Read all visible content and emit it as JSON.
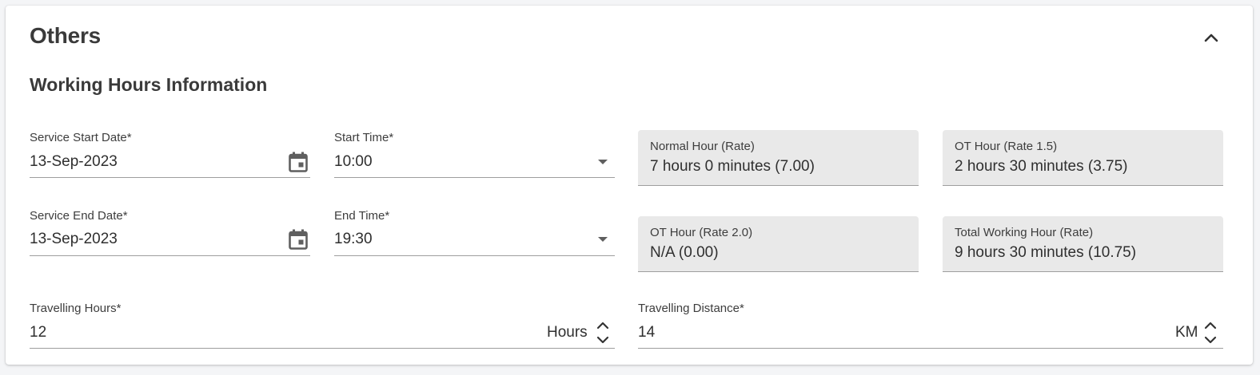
{
  "panel": {
    "title": "Others",
    "collapse_icon": "chevron-up-icon"
  },
  "section": {
    "title": "Working Hours Information"
  },
  "fields": {
    "service_start_date": {
      "label": "Service Start Date*",
      "value": "13-Sep-2023",
      "icon": "calendar-icon"
    },
    "start_time": {
      "label": "Start Time*",
      "value": "10:00",
      "icon": "dropdown-arrow-icon"
    },
    "service_end_date": {
      "label": "Service End Date*",
      "value": "13-Sep-2023",
      "icon": "calendar-icon"
    },
    "end_time": {
      "label": "End Time*",
      "value": "19:30",
      "icon": "dropdown-arrow-icon"
    },
    "travelling_hours": {
      "label": "Travelling Hours*",
      "value": "12",
      "suffix": "Hours"
    },
    "travelling_distance": {
      "label": "Travelling Distance*",
      "value": "14",
      "suffix": "KM"
    }
  },
  "summary": {
    "normal_hour": {
      "label": "Normal Hour (Rate)",
      "value": "7 hours 0 minutes (7.00)"
    },
    "ot_hour_1_5": {
      "label": "OT Hour (Rate 1.5)",
      "value": "2 hours 30 minutes (3.75)"
    },
    "ot_hour_2_0": {
      "label": "OT Hour (Rate 2.0)",
      "value": "N/A (0.00)"
    },
    "total_working_hour": {
      "label": "Total Working Hour (Rate)",
      "value": "9 hours 30 minutes (10.75)"
    }
  },
  "colors": {
    "readonly_background": "#e9e9e9",
    "underline": "#9e9e9e",
    "icon": "#5f5f5f"
  }
}
